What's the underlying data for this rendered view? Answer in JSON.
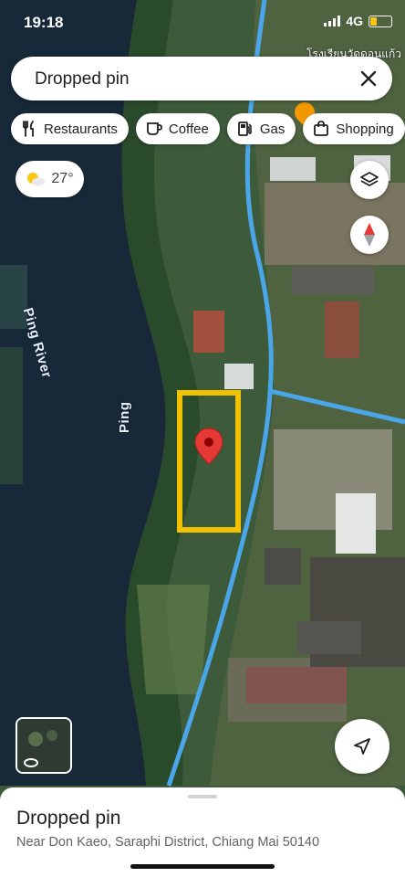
{
  "status_bar": {
    "time": "19:18",
    "network": "4G"
  },
  "search": {
    "text": "Dropped pin"
  },
  "chips": [
    {
      "icon": "fork-knife-icon",
      "label": "Restaurants"
    },
    {
      "icon": "coffee-icon",
      "label": "Coffee"
    },
    {
      "icon": "gas-pump-icon",
      "label": "Gas"
    },
    {
      "icon": "shopping-bag-icon",
      "label": "Shopping"
    }
  ],
  "weather": {
    "temperature": "27°",
    "icon": "partly-sunny-icon"
  },
  "map": {
    "river_labels": [
      "Ping River",
      "Ping"
    ],
    "poi_text": "โรงเรียนวัดดอนแก้ว",
    "road_color": "#4aa6e8",
    "highlight_color": "#f2c200",
    "pin_color": "#e53935"
  },
  "bottom_sheet": {
    "title": "Dropped pin",
    "address": "Near Don Kaeo, Saraphi District, Chiang Mai 50140"
  }
}
